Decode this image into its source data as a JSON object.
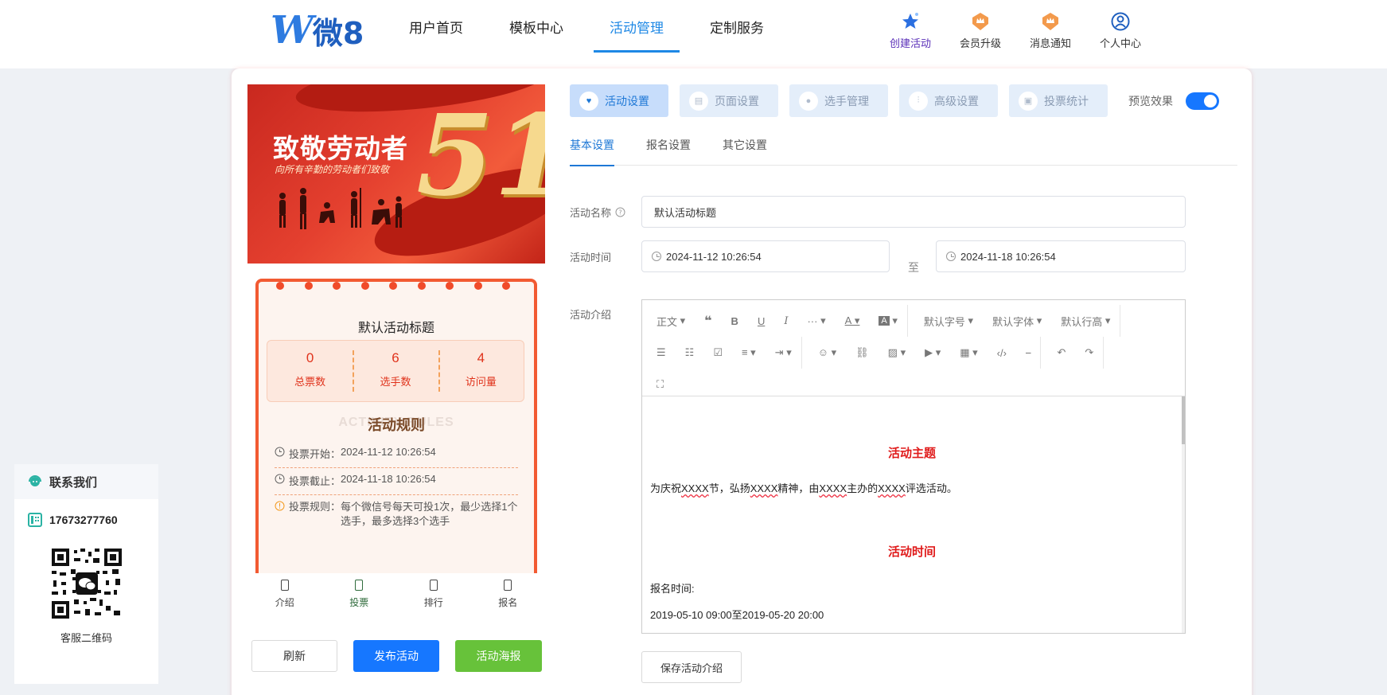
{
  "header": {
    "logo_text": "微8",
    "nav": [
      "用户首页",
      "模板中心",
      "活动管理",
      "定制服务"
    ],
    "actions": [
      "创建活动",
      "会员升级",
      "消息通知",
      "个人中心"
    ]
  },
  "preview": {
    "banner_title": "致敬劳动者",
    "banner_sub": "向所有辛勤的劳动者们致敬",
    "banner_number": "51",
    "vote_title": "默认活动标题",
    "stats": [
      {
        "num": "0",
        "label": "总票数"
      },
      {
        "num": "6",
        "label": "选手数"
      },
      {
        "num": "4",
        "label": "访问量"
      }
    ],
    "rules_bg": "ACTIVITY RULES",
    "rules_title": "活动规则",
    "rules": [
      {
        "key": "投票开始：",
        "value": "2024-11-12 10:26:54"
      },
      {
        "key": "投票截止：",
        "value": "2024-11-18 10:26:54"
      },
      {
        "key": "投票规则：",
        "value": "每个微信号每天可投1次，最少选择1个选手，最多选择3个选手"
      }
    ],
    "tabs": [
      "介绍",
      "投票",
      "排行",
      "报名"
    ],
    "buttons": {
      "refresh": "刷新",
      "publish": "发布活动",
      "poster": "活动海报"
    }
  },
  "settings": {
    "steps": [
      "活动设置",
      "页面设置",
      "选手管理",
      "高级设置",
      "投票统计"
    ],
    "preview_label": "预览效果",
    "subtabs": [
      "基本设置",
      "报名设置",
      "其它设置"
    ],
    "name_label": "活动名称",
    "name_value": "默认活动标题",
    "time_label": "活动时间",
    "start_time": "2024-11-12 10:26:54",
    "to_label": "至",
    "end_time": "2024-11-18 10:26:54",
    "intro_label": "活动介绍",
    "toolbar": {
      "paragraph": "正文",
      "more": "···",
      "font_size": "默认字号",
      "font_family": "默认字体",
      "line_height": "默认行高"
    },
    "content": {
      "h1": "活动主题",
      "p1_parts": [
        "为庆祝",
        "XXXX",
        "节，弘扬",
        "XXXX",
        "精神，由",
        "XXXX",
        "主办的",
        "XXXX",
        "评选活动。"
      ],
      "h2": "活动时间",
      "p2": "报名时间:",
      "p3": "2019-05-10 09:00至2019-05-20 20:00"
    },
    "save_button": "保存活动介绍"
  },
  "contact": {
    "title": "联系我们",
    "phone": "17673277760",
    "qr_label": "客服二维码"
  },
  "colors": {
    "primary": "#1677ff",
    "accent_red": "#e0331c",
    "success": "#67c23a"
  }
}
